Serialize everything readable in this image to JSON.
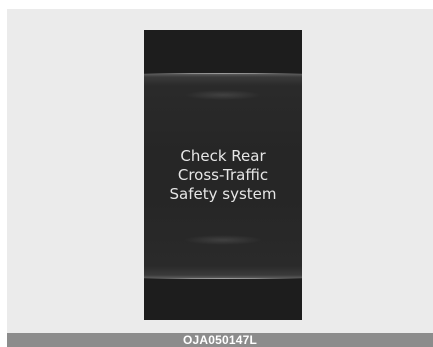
{
  "display": {
    "message_lines": [
      "Check Rear",
      "Cross-Traffic",
      "Safety system"
    ]
  },
  "caption": {
    "code": "OJA050147L"
  }
}
